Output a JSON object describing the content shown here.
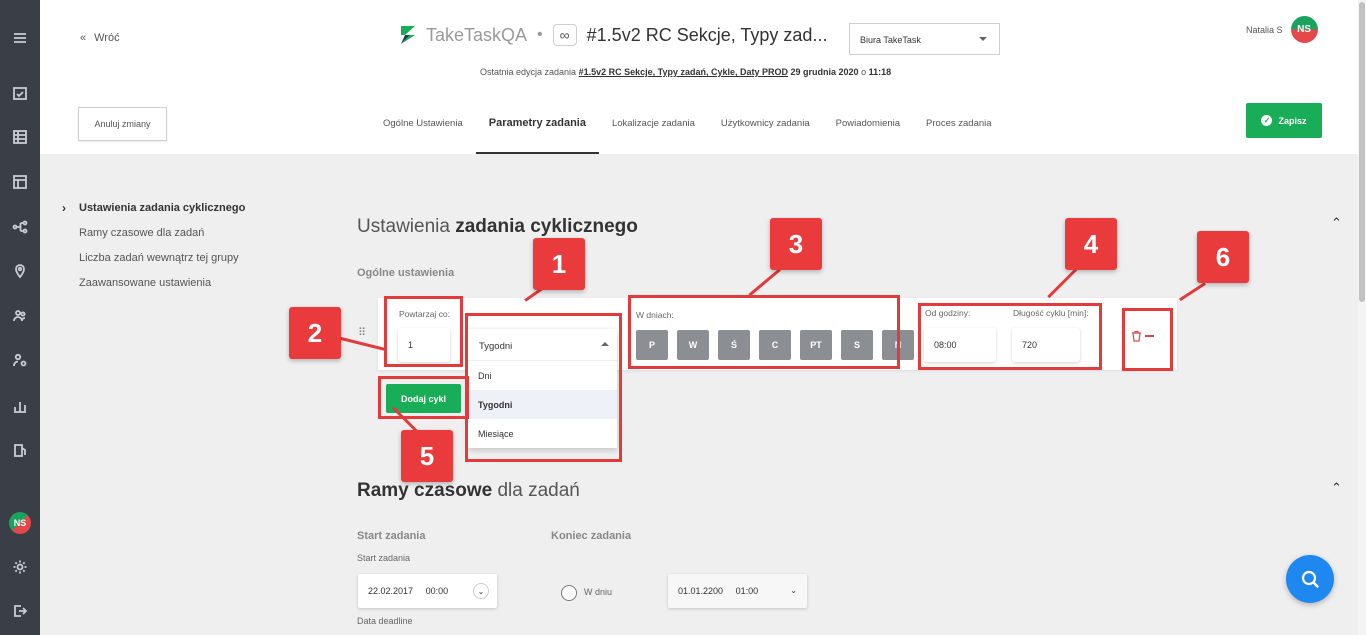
{
  "rail": {
    "icons": [
      "menu-icon",
      "checklist-icon",
      "grid-icon",
      "layout-icon",
      "flow-icon",
      "location-icon",
      "users-icon",
      "user-settings-icon",
      "stats-icon",
      "fuel-icon",
      "gear-icon",
      "logout-icon"
    ],
    "avatar_initials": "NS"
  },
  "header": {
    "back_label": "Wróć",
    "app_name": "TakeTaskQA",
    "separator": "•",
    "task_name": "#1.5v2 RC Sekcje, Typy zad...",
    "office_select": "Biura TakeTask",
    "last_edit_prefix": "Ostatnia edycja zadania",
    "last_edit_task": "#1.5v2 RC Sekcje, Typy zadań, Cykle, Daty PROD",
    "last_edit_date": "29 grudnia 2020",
    "last_edit_o": "o",
    "last_edit_time": "11:18",
    "user_name": "Natalia S",
    "user_initials": "NS",
    "cancel_label": "Anuluj zmiany",
    "save_label": "Zapisz",
    "tabs": [
      "Ogólne Ustawienia",
      "Parametry zadania",
      "Lokalizacje zadania",
      "Użytkownicy zadania",
      "Powiadomienia",
      "Proces zadania"
    ]
  },
  "sidenav": [
    "Ustawienia zadania cyklicznego",
    "Ramy czasowe dla zadań",
    "Liczba zadań wewnątrz tej grupy",
    "Zaawansowane ustawienia"
  ],
  "cyclic": {
    "title_light": "Ustawienia",
    "title_bold": "zadania cyklicznego",
    "general_label": "Ogólne ustawienia",
    "repeat_label": "Powtarzaj co:",
    "repeat_value": "1",
    "period_selected": "Tygodni",
    "period_options": [
      "Dni",
      "Tygodni",
      "Miesiące"
    ],
    "days_label": "W dniach:",
    "days": [
      "P",
      "W",
      "Ś",
      "C",
      "PT",
      "S",
      "N"
    ],
    "from_hour_label": "Od godziny:",
    "from_hour_value": "08:00",
    "duration_label": "Długość cyklu [min]:",
    "duration_value": "720",
    "add_cycle_label": "Dodaj cykl"
  },
  "timeframe": {
    "title_bold": "Ramy czasowe",
    "title_light": "dla zadań",
    "start_title": "Start zadania",
    "start_label": "Start zadania",
    "start_date": "22.02.2017",
    "start_time": "00:00",
    "end_title": "Koniec zadania",
    "on_day_label": "W dniu",
    "end_date": "01.01.2200",
    "end_time": "01:00",
    "deadline_label": "Data deadline"
  },
  "annotations": [
    "1",
    "2",
    "3",
    "4",
    "5",
    "6"
  ],
  "colors": {
    "accent_green": "#1aad57",
    "annotation_red": "#e23b3b",
    "fab_blue": "#1f87f0",
    "rail_bg": "#3a3e46"
  }
}
